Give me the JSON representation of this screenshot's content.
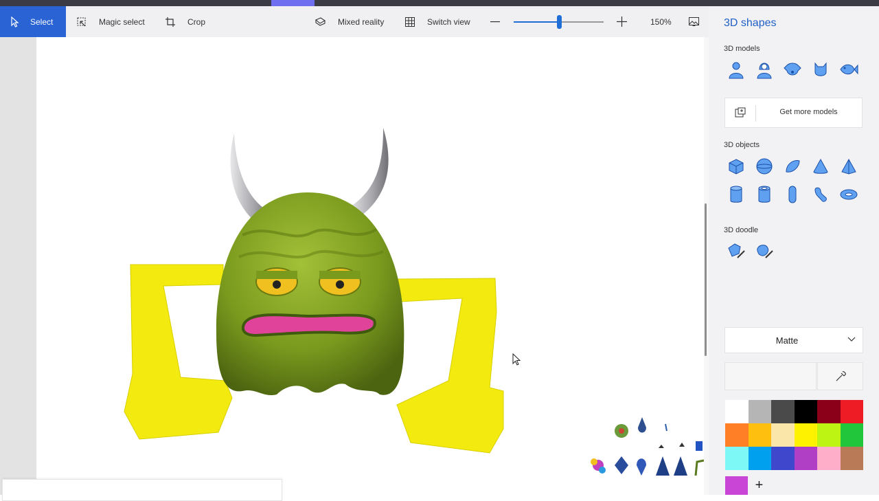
{
  "toolbar": {
    "select_label": "Select",
    "magic_select_label": "Magic select",
    "crop_label": "Crop",
    "mixed_reality_label": "Mixed reality",
    "switch_view_label": "Switch view",
    "zoom_percent": "150%",
    "zoom_level": 0.5
  },
  "panel": {
    "title": "3D shapes",
    "models_label": "3D models",
    "models": [
      "man-icon",
      "woman-icon",
      "dog-icon",
      "cat-icon",
      "fish-icon"
    ],
    "get_more_label": "Get more models",
    "objects_label": "3D objects",
    "objects": [
      "cube-icon",
      "sphere-icon",
      "hemisphere-icon",
      "cone-icon",
      "pyramid-icon",
      "cylinder-icon",
      "tube-icon",
      "capsule-icon",
      "curved-tube-icon",
      "donut-icon"
    ],
    "doodle_label": "3D doodle",
    "doodles": [
      "sharp-edge-doodle-icon",
      "soft-edge-doodle-icon"
    ],
    "material": "Matte",
    "colors": [
      "#ffffff",
      "#b5b5b5",
      "#4a4a4a",
      "#000000",
      "#8b0018",
      "#ee1c24",
      "#ff7f27",
      "#ffbf0f",
      "#fae6a8",
      "#fff200",
      "#bef413",
      "#22c63a",
      "#7df8f6",
      "#00a0ef",
      "#3f48cc",
      "#b03fc5",
      "#ffaec9",
      "#b97a57"
    ],
    "custom_color": "#c945d6"
  },
  "colors": {
    "accent": "#2a63d4",
    "monster_body": "#7a9a1e",
    "monster_arms": "#f5ec10",
    "mouth": "#e0449a",
    "horns": "#b8b8bc"
  }
}
